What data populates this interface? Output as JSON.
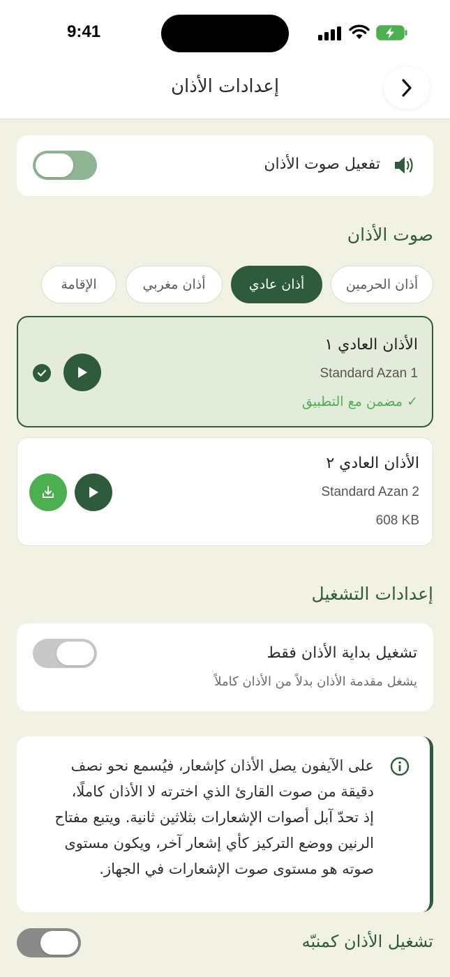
{
  "status": {
    "time": "9:41"
  },
  "header": {
    "title": "إعدادات الأذان"
  },
  "sound_toggle": {
    "label": "تفعيل صوت الأذان",
    "on": true
  },
  "azan_sound": {
    "section_title": "صوت الأذان",
    "chips": [
      {
        "label": "أذان الحرمين",
        "active": false
      },
      {
        "label": "أذان عادي",
        "active": true
      },
      {
        "label": "أذان مغربي",
        "active": false
      },
      {
        "label": "الإقامة",
        "active": false
      }
    ],
    "items": [
      {
        "title": "الأذان العادي ١",
        "subtitle": "Standard Azan 1",
        "note": "✓ مضمن مع التطبيق",
        "selected": true
      },
      {
        "title": "الأذان العادي ٢",
        "subtitle": "Standard Azan 2",
        "note": "608 KB",
        "selected": false
      }
    ]
  },
  "playback": {
    "section_title": "إعدادات التشغيل",
    "start_only": {
      "label": "تشغيل بداية الأذان فقط",
      "description": "يشغل مقدمة الأذان بدلاً من الأذان كاملاً",
      "on": false
    }
  },
  "notice": {
    "lines": [
      "على الآيفون يصل الأذان كإشعار، فيُسمع نحو نصف",
      "دقيقة من صوت القارئ الذي اخترته لا الأذان كاملًا،",
      "إذ تحدّ آبل أصوات الإشعارات بثلاثين ثانية. ويتبع مفتاح",
      "الرنين ووضع التركيز كأي إشعار آخر، ويكون مستوى",
      "صوته هو مستوى صوت الإشعارات في الجهاز."
    ]
  },
  "alarm": {
    "label": "تشغيل الأذان كمنبّه",
    "on": false
  },
  "colors": {
    "accent": "#2e5b3c",
    "accent_light": "#4caf50",
    "toggle_on": "#8fb593",
    "background": "#f1f1e4"
  }
}
